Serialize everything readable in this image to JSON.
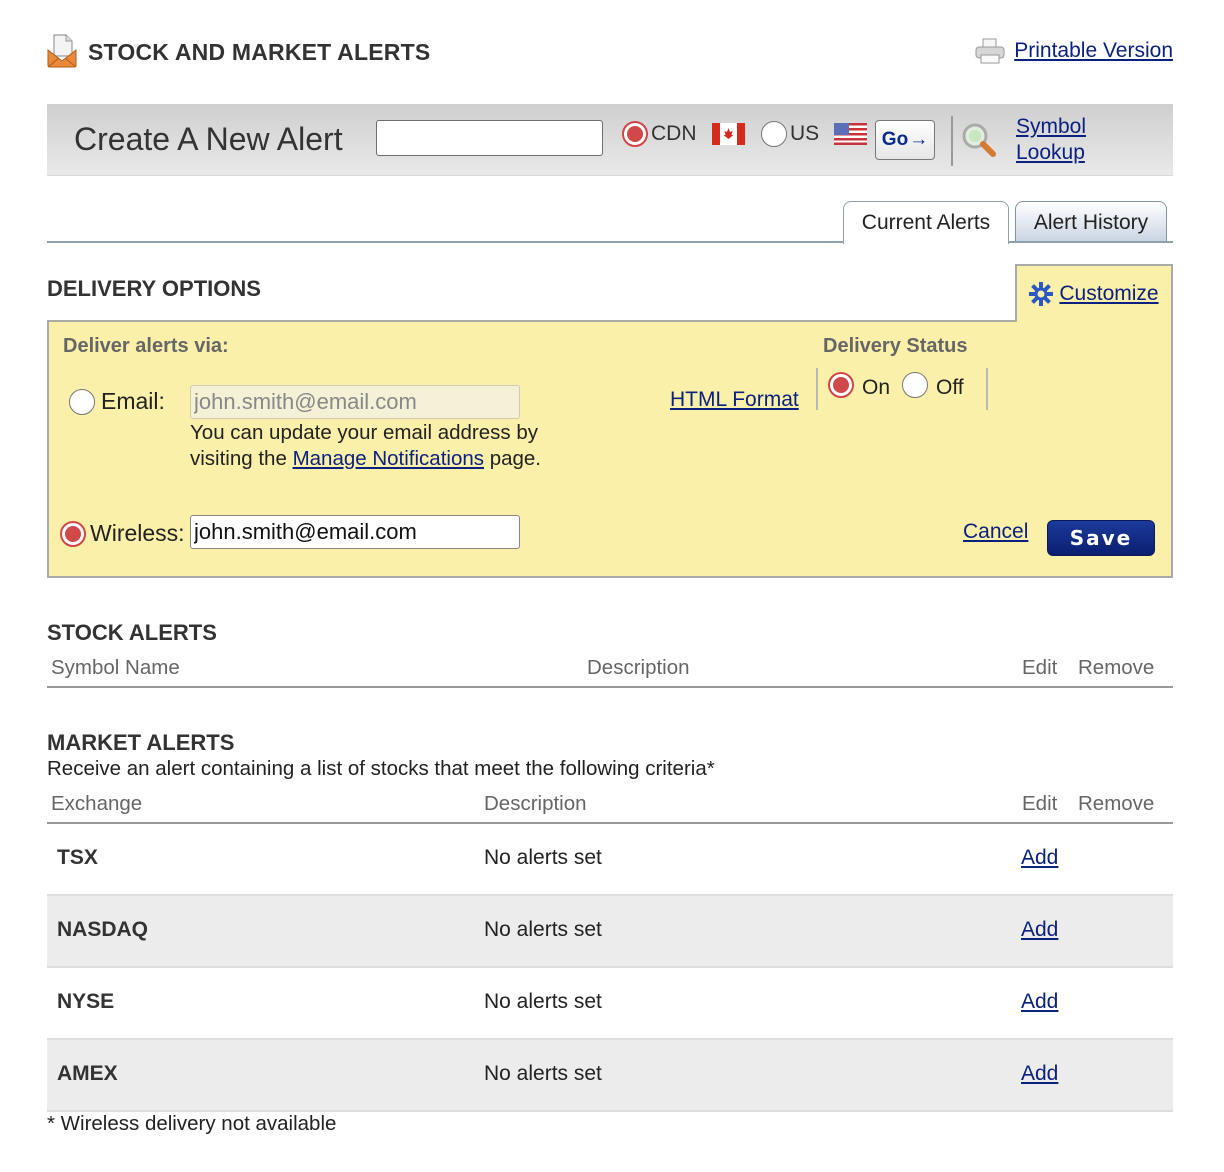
{
  "header": {
    "title": "STOCK AND MARKET ALERTS",
    "printable_link": "Printable Version"
  },
  "create_alert": {
    "label": "Create A New Alert",
    "symbol_input": {
      "value": "",
      "placeholder": ""
    },
    "markets": [
      {
        "label": "CDN",
        "selected": true,
        "flag": "canada-flag"
      },
      {
        "label": "US",
        "selected": false,
        "flag": "us-flag"
      }
    ],
    "go_label": "Go",
    "symbol_lookup_line1": "Symbol",
    "symbol_lookup_line2": "Lookup"
  },
  "tabs": [
    {
      "label": "Current Alerts",
      "active": true
    },
    {
      "label": "Alert History",
      "active": false
    }
  ],
  "delivery": {
    "heading": "DELIVERY OPTIONS",
    "customize_label": "Customize",
    "deliver_via_label": "Deliver alerts via:",
    "email": {
      "label": "Email:",
      "selected": false,
      "value": "john.smith@email.com",
      "disabled": true
    },
    "help_text_before": "You can update your email address by visiting the ",
    "help_link": "Manage Notifications",
    "help_text_after": " page.",
    "wireless": {
      "label": "Wireless:",
      "selected": true,
      "value": "john.smith@email.com"
    },
    "html_format_link": "HTML Format",
    "status_label": "Delivery Status",
    "status_options": [
      {
        "label": "On",
        "selected": true
      },
      {
        "label": "Off",
        "selected": false
      }
    ],
    "cancel_label": "Cancel",
    "save_label": "Save"
  },
  "stock_alerts": {
    "heading": "STOCK ALERTS",
    "columns": [
      "Symbol Name",
      "Description",
      "Edit",
      "Remove"
    ],
    "rows": []
  },
  "market_alerts": {
    "heading": "MARKET ALERTS",
    "subtitle": "Receive an alert containing a list of stocks that meet the following criteria*",
    "columns": [
      "Exchange",
      "Description",
      "Edit",
      "Remove"
    ],
    "rows": [
      {
        "exchange": "TSX",
        "description": "No alerts set",
        "action": "Add"
      },
      {
        "exchange": "NASDAQ",
        "description": "No alerts set",
        "action": "Add"
      },
      {
        "exchange": "NYSE",
        "description": "No alerts set",
        "action": "Add"
      },
      {
        "exchange": "AMEX",
        "description": "No alerts set",
        "action": "Add"
      }
    ],
    "footnote": "* Wireless delivery not available"
  }
}
